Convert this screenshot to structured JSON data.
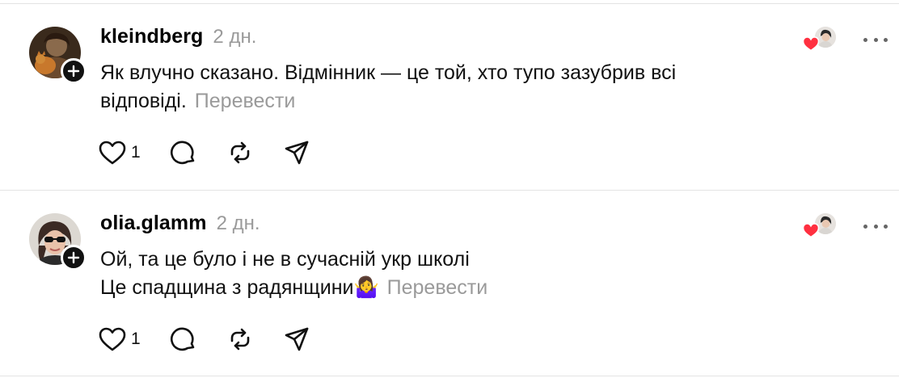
{
  "posts": [
    {
      "username": "kleindberg",
      "time": "2 дн.",
      "text_lines": [
        "Як влучно сказано. Відмінник — це той, хто тупо зазубрив всі",
        "відповіді."
      ],
      "translate_label": "Перевести",
      "like_count": "1",
      "icons": [
        "heart-icon",
        "comment-icon",
        "repost-icon",
        "share-icon",
        "more-icon"
      ]
    },
    {
      "username": "olia.glamm",
      "time": "2 дн.",
      "text_lines": [
        "Ой, та це було і не в сучасній укр школі",
        "Це спадщина з радянщини🤷‍♀️"
      ],
      "translate_label": "Перевести",
      "like_count": "1",
      "icons": [
        "heart-icon",
        "comment-icon",
        "repost-icon",
        "share-icon",
        "more-icon"
      ]
    }
  ],
  "colors": {
    "text": "#111111",
    "muted": "#9a9a9a",
    "divider": "#e3e3e3",
    "heart_red": "#ff3040",
    "badge": "#111111"
  }
}
